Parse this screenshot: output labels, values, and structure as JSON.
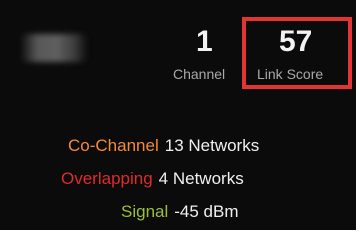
{
  "stats": {
    "channel": {
      "value": "1",
      "label": "Channel"
    },
    "link_score": {
      "value": "57",
      "label": "Link Score"
    }
  },
  "metrics": [
    {
      "label": "Co-Channel",
      "value": "13 Networks",
      "label_color": "#f28a3a"
    },
    {
      "label": "Overlapping",
      "value": "4 Networks",
      "label_color": "#e02b2b"
    },
    {
      "label": "Signal",
      "value": "-45 dBm",
      "label_color": "#9bbf3b"
    }
  ],
  "colors": {
    "panel_bg": "#0b0b0b",
    "highlight_border": "#e23434",
    "value_text": "#f2f2f2",
    "label_text": "#a9a9a9"
  }
}
